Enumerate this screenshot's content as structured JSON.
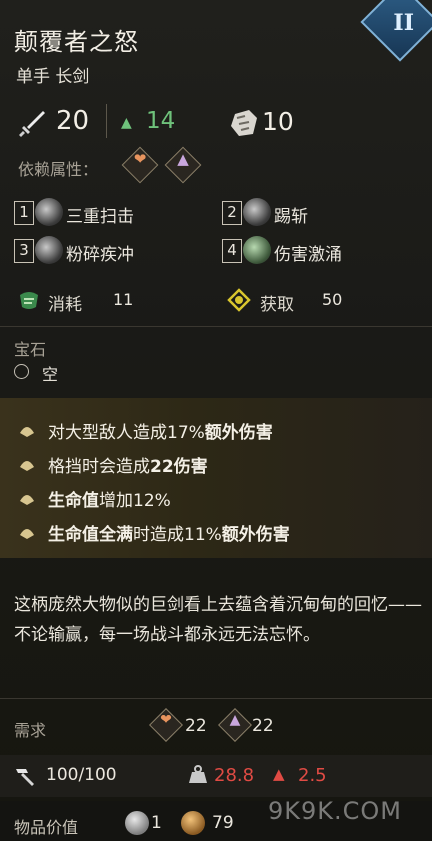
{
  "item": {
    "name": "颠覆者之怒",
    "type": "单手 长剑",
    "tier": "II"
  },
  "stats": {
    "attack": "20",
    "upgrade": "14",
    "stagger": "10"
  },
  "dependency": {
    "label": "依赖属性："
  },
  "skills": [
    {
      "num": "1",
      "name": "三重扫击"
    },
    {
      "num": "2",
      "name": "踢斩"
    },
    {
      "num": "3",
      "name": "粉碎疾冲"
    },
    {
      "num": "4",
      "name": "伤害激涌"
    }
  ],
  "resources": {
    "consume_label": "消耗",
    "consume_value": "11",
    "gain_label": "获取",
    "gain_value": "50"
  },
  "gems": {
    "title": "宝石",
    "slot": "空"
  },
  "affixes": [
    {
      "pre": "对大型敌人造成17%",
      "bold": "额外伤害",
      "post": ""
    },
    {
      "pre": "格挡时会造成",
      "bold": "22伤害",
      "post": ""
    },
    {
      "pre": "",
      "bold": "生命值",
      "post": "增加12%"
    },
    {
      "pre": "",
      "bold": "生命值全满",
      "post": "时造成11%",
      "bold2": "额外伤害"
    }
  ],
  "lore": "这柄庞然大物似的巨剑看上去蕴含着沉甸甸的回忆——不论输赢，每一场战斗都永远无法忘怀。",
  "requirements": {
    "label": "需求",
    "req1": "22",
    "req2": "22"
  },
  "durability": {
    "value": "100/100",
    "weight": "28.8",
    "warning": "2.5"
  },
  "value": {
    "label": "物品价值",
    "silver": "1",
    "gold": "79"
  },
  "watermark": "9K9K.COM",
  "colors": {
    "accent_green": "#6fc27b",
    "warning_red": "#e04b44",
    "tier_blue": "#2e5f88",
    "affix_gold": "#3a321c"
  }
}
